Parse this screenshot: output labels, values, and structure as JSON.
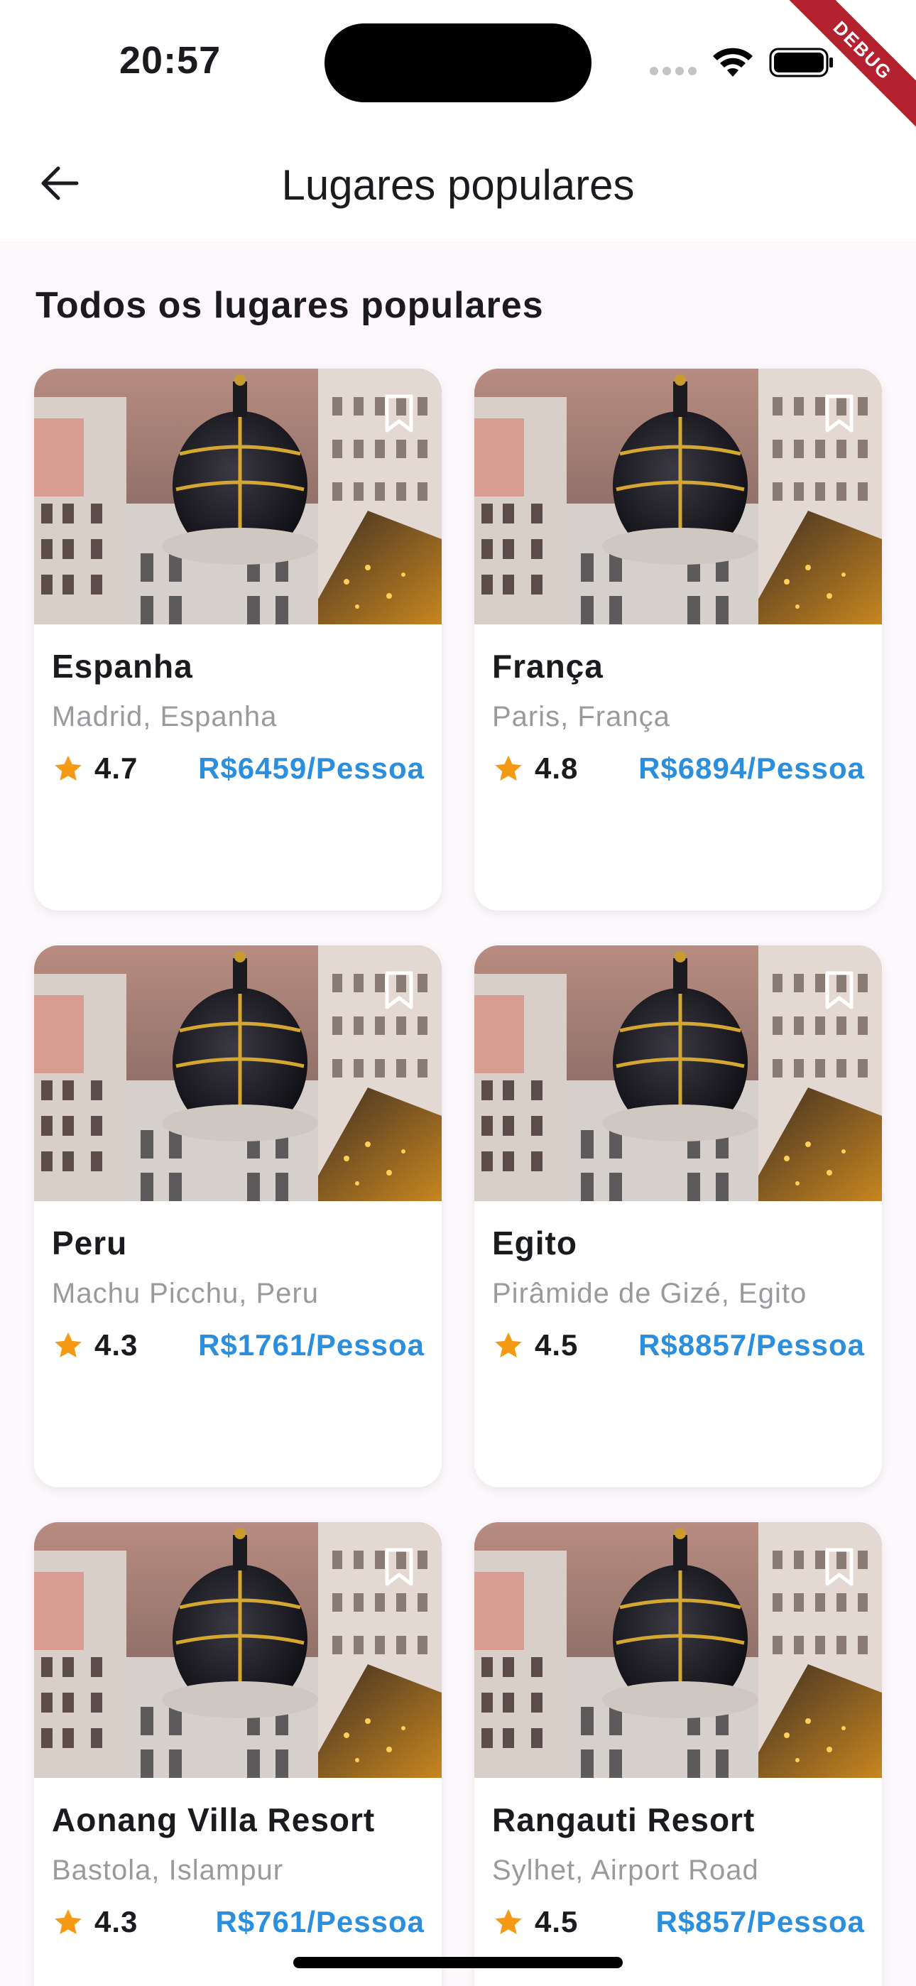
{
  "status_bar": {
    "time": "20:57",
    "debug_label": "DEBUG"
  },
  "app_bar": {
    "title": "Lugares populares"
  },
  "section_title": "Todos os lugares populares",
  "places": [
    {
      "name": "Espanha",
      "location": "Madrid, Espanha",
      "rating": "4.7",
      "price": "R$6459/Pessoa"
    },
    {
      "name": "França",
      "location": "Paris, França",
      "rating": "4.8",
      "price": "R$6894/Pessoa"
    },
    {
      "name": "Peru",
      "location": "Machu Picchu, Peru",
      "rating": "4.3",
      "price": "R$1761/Pessoa"
    },
    {
      "name": "Egito",
      "location": "Pirâmide de Gizé, Egito",
      "rating": "4.5",
      "price": "R$8857/Pessoa"
    },
    {
      "name": "Aonang Villa Resort",
      "location": "Bastola, Islampur",
      "rating": "4.3",
      "price": "R$761/Pessoa"
    },
    {
      "name": "Rangauti Resort",
      "location": "Sylhet, Airport Road",
      "rating": "4.5",
      "price": "R$857/Pessoa"
    }
  ],
  "colors": {
    "price": "#2b8fdd",
    "star": "#f59a14",
    "background": "#fcf8fc",
    "debug": "#b3232f"
  },
  "icons": {
    "back": "arrow-left-icon",
    "bookmark": "bookmark-outline-icon",
    "rating": "star-icon"
  }
}
